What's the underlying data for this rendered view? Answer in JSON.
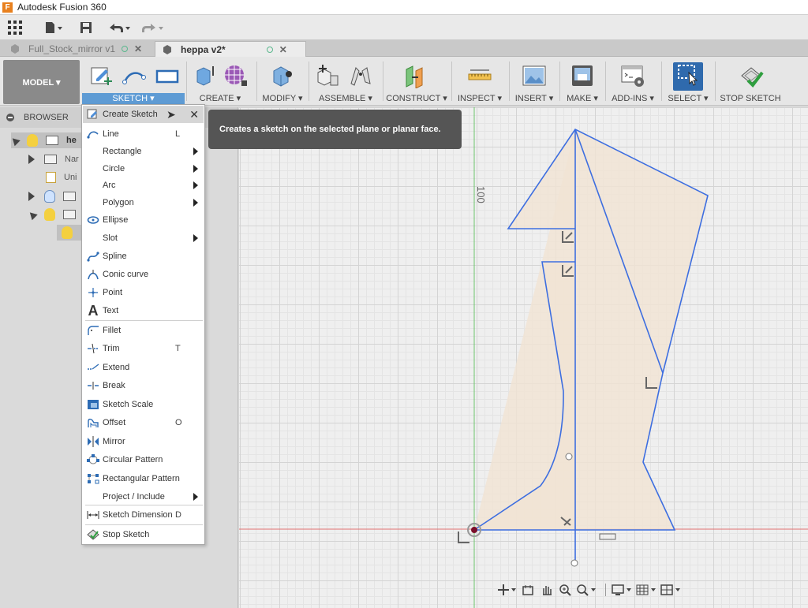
{
  "app": {
    "title": "Autodesk Fusion 360",
    "icon_letter": "F"
  },
  "quick_access": {
    "items": [
      "grid-icon",
      "file-icon",
      "save-icon",
      "undo-icon",
      "redo-icon"
    ]
  },
  "doc_tabs": [
    {
      "label": "Full_Stock_mirror v1",
      "active": false
    },
    {
      "label": "heppa v2*",
      "active": true
    }
  ],
  "ribbon": {
    "workspace": "MODEL ▾",
    "groups": [
      {
        "label": "SKETCH ▾"
      },
      {
        "label": "CREATE ▾"
      },
      {
        "label": "MODIFY ▾"
      },
      {
        "label": "ASSEMBLE ▾"
      },
      {
        "label": "CONSTRUCT ▾"
      },
      {
        "label": "INSPECT ▾"
      },
      {
        "label": "INSERT ▾"
      },
      {
        "label": "MAKE ▾"
      },
      {
        "label": "ADD-INS ▾"
      },
      {
        "label": "SELECT ▾"
      },
      {
        "label": "STOP SKETCH"
      }
    ]
  },
  "browser": {
    "title": "BROWSER",
    "rows": [
      {
        "text": "he"
      },
      {
        "text": "Nar"
      },
      {
        "text": "Uni"
      }
    ]
  },
  "tooltip": {
    "text": "Creates a sketch on the selected plane or planar face."
  },
  "sketch_menu": {
    "items": [
      {
        "label": "Create Sketch",
        "shortcut": "",
        "submenu": false,
        "highlighted": true,
        "close": "✕"
      },
      {
        "label": "Line",
        "shortcut": "L",
        "submenu": false
      },
      {
        "label": "Rectangle",
        "shortcut": "",
        "submenu": true
      },
      {
        "label": "Circle",
        "shortcut": "",
        "submenu": true
      },
      {
        "label": "Arc",
        "shortcut": "",
        "submenu": true
      },
      {
        "label": "Polygon",
        "shortcut": "",
        "submenu": true
      },
      {
        "label": "Ellipse",
        "shortcut": "",
        "submenu": false
      },
      {
        "label": "Slot",
        "shortcut": "",
        "submenu": true
      },
      {
        "label": "Spline",
        "shortcut": "",
        "submenu": false
      },
      {
        "label": "Conic curve",
        "shortcut": "",
        "submenu": false
      },
      {
        "label": "Point",
        "shortcut": "",
        "submenu": false
      },
      {
        "label": "Text",
        "shortcut": "",
        "submenu": false
      },
      {
        "label": "Fillet",
        "shortcut": "",
        "submenu": false
      },
      {
        "label": "Trim",
        "shortcut": "T",
        "submenu": false
      },
      {
        "label": "Extend",
        "shortcut": "",
        "submenu": false
      },
      {
        "label": "Break",
        "shortcut": "",
        "submenu": false
      },
      {
        "label": "Sketch Scale",
        "shortcut": "",
        "submenu": false
      },
      {
        "label": "Offset",
        "shortcut": "O",
        "submenu": false
      },
      {
        "label": "Mirror",
        "shortcut": "",
        "submenu": false
      },
      {
        "label": "Circular Pattern",
        "shortcut": "",
        "submenu": false
      },
      {
        "label": "Rectangular Pattern",
        "shortcut": "",
        "submenu": false
      },
      {
        "label": "Project / Include",
        "shortcut": "",
        "submenu": true
      },
      {
        "label": "Sketch Dimension",
        "shortcut": "D",
        "submenu": false
      },
      {
        "label": "Stop Sketch",
        "shortcut": "",
        "submenu": false
      }
    ]
  },
  "canvas": {
    "dimension_label": "100",
    "colors": {
      "sketch_line": "#3d6ee0",
      "profile_fill": "#f1e3d3",
      "x_axis": "#e07070",
      "y_axis": "#6cc46c"
    }
  },
  "navbar": {
    "items": [
      "orbit-icon",
      "look-at-icon",
      "pan-icon",
      "zoom-window-icon",
      "zoom-icon",
      "display-settings-icon",
      "grid-settings-icon",
      "viewports-icon"
    ]
  }
}
